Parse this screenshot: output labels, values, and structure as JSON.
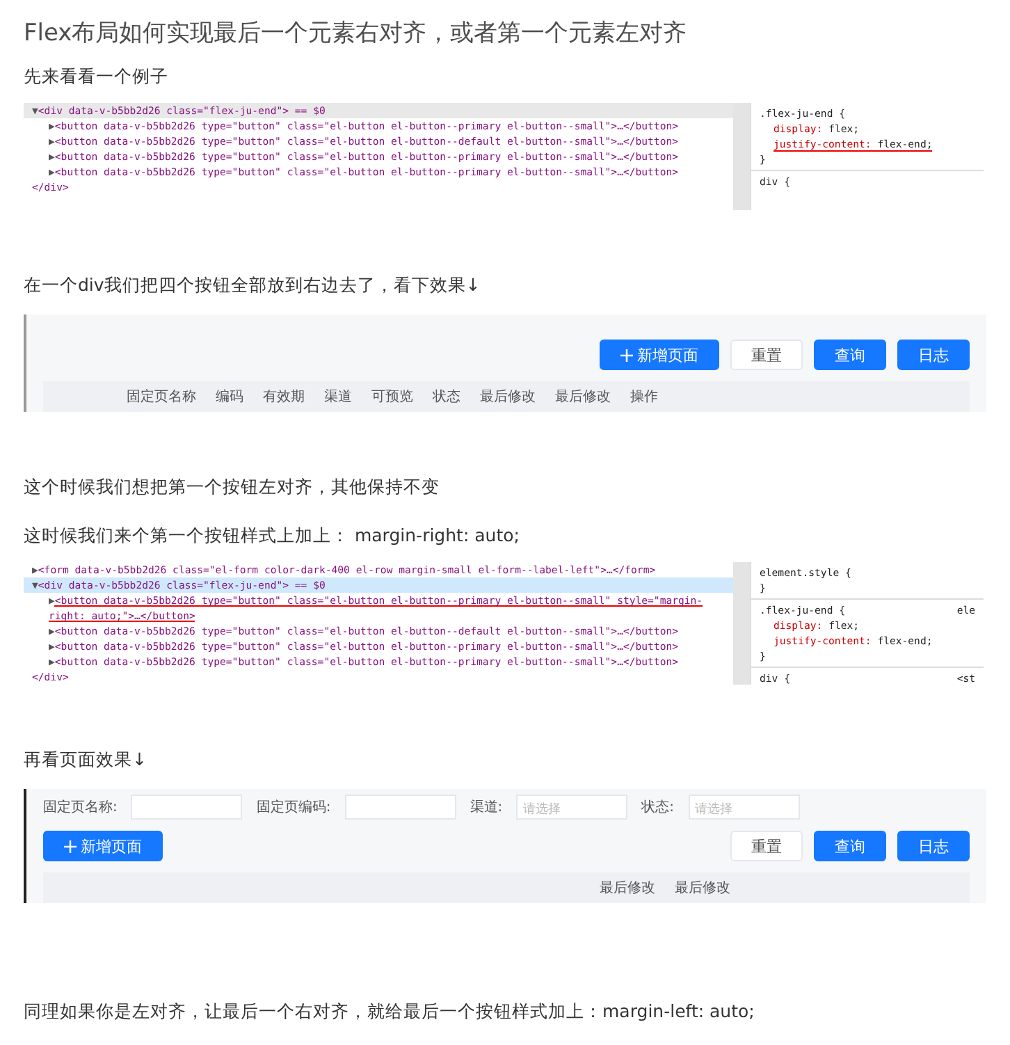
{
  "title": "Flex布局如何实现最后一个元素右对齐，或者第一个元素左对齐",
  "blocks": [
    {
      "kind": "text",
      "text": "先来看看一个例子"
    },
    {
      "kind": "devtools",
      "lines": [
        {
          "toggle": "▼",
          "text": "<div data-v-b5bb2d26 class=\"flex-ju-end\"> == $0",
          "selected": true,
          "underlined": false
        },
        {
          "toggle": "▶",
          "text": "<button data-v-b5bb2d26 type=\"button\" class=\"el-button el-button--primary el-button--small\">…</button>",
          "selected": false,
          "underlined": false
        },
        {
          "toggle": "▶",
          "text": "<button data-v-b5bb2d26 type=\"button\" class=\"el-button el-button--default el-button--small\">…</button>",
          "selected": false,
          "underlined": false
        },
        {
          "toggle": "▶",
          "text": "<button data-v-b5bb2d26 type=\"button\" class=\"el-button el-button--primary el-button--small\">…</button>",
          "selected": false,
          "underlined": false
        },
        {
          "toggle": "▶",
          "text": "<button data-v-b5bb2d26 type=\"button\" class=\"el-button el-button--primary el-button--small\">…</button>",
          "selected": false,
          "underlined": false
        },
        {
          "text": "</div>",
          "selected": false,
          "underlined": false
        }
      ],
      "styles": [
        {
          "kind": "selector",
          "text": ".flex-ju-end {"
        },
        {
          "kind": "prop",
          "name": "display:",
          "value": "flex;",
          "underlined": false
        },
        {
          "kind": "prop",
          "name": "justify-content:",
          "value": "flex-end;",
          "underlined": true
        },
        {
          "kind": "selector",
          "text": "}"
        },
        {
          "kind": "rule"
        },
        {
          "kind": "selector",
          "text": "div {"
        }
      ]
    },
    {
      "kind": "text",
      "text": "在一个div我们把四个按钮全部放到右边去了，看下效果↓"
    },
    {
      "kind": "preview",
      "buttons": [
        {
          "label": "新增页面",
          "kind": "add"
        },
        {
          "label": "重置",
          "kind": "default"
        },
        {
          "label": "查询",
          "kind": "primary"
        },
        {
          "label": "日志",
          "kind": "primary"
        }
      ],
      "columns": [
        "固定页名称",
        "编码",
        "有效期",
        "渠道",
        "可预览",
        "状态",
        "最后修改",
        "最后修改",
        "操作"
      ]
    },
    {
      "kind": "text",
      "text": "这个时候我们想把第一个按钮左对齐，其他保持不变"
    },
    {
      "kind": "text",
      "text": "这时候我们来个第一个按钮样式上加上： margin-right: auto;"
    },
    {
      "kind": "devtools",
      "lines": [
        {
          "toggle": "▶",
          "text": "<form data-v-b5bb2d26 class=\"el-form color-dark-400 el-row margin-small el-form--label-left\">…</form>",
          "selected": false,
          "underlined": false
        },
        {
          "toggle": "▼",
          "text": "<div data-v-b5bb2d26 class=\"flex-ju-end\"> == $0",
          "selected": true,
          "underlined": false
        },
        {
          "toggle": "▶",
          "text": "<button data-v-b5bb2d26 type=\"button\" class=\"el-button el-button--primary el-button--small\" style=\"margin-right: auto;\">…</button>",
          "selected": false,
          "underlined": true
        },
        {
          "toggle": "▶",
          "text": "<button data-v-b5bb2d26 type=\"button\" class=\"el-button el-button--default el-button--small\">…</button>",
          "selected": false,
          "underlined": false
        },
        {
          "toggle": "▶",
          "text": "<button data-v-b5bb2d26 type=\"button\" class=\"el-button el-button--primary el-button--small\">…</button>",
          "selected": false,
          "underlined": false
        },
        {
          "toggle": "▶",
          "text": "<button data-v-b5bb2d26 type=\"button\" class=\"el-button el-button--primary el-button--small\">…</button>",
          "selected": false,
          "underlined": false
        },
        {
          "text": "</div>",
          "selected": false,
          "underlined": false
        }
      ],
      "styles": [
        {
          "kind": "selector",
          "text": "element.style {"
        },
        {
          "kind": "selector",
          "text": "}"
        },
        {
          "kind": "rule"
        },
        {
          "kind": "selector",
          "text": ".flex-ju-end {",
          "aside": "ele"
        },
        {
          "kind": "prop",
          "name": "display:",
          "value": "flex;",
          "underlined": false
        },
        {
          "kind": "prop",
          "name": "justify-content:",
          "value": "flex-end;",
          "underlined": false
        },
        {
          "kind": "selector",
          "text": "}"
        },
        {
          "kind": "rule"
        },
        {
          "kind": "selector",
          "text": "div {",
          "aside": "<st"
        }
      ]
    },
    {
      "kind": "text",
      "text": "再看页面效果↓"
    },
    {
      "kind": "preview",
      "form": [
        {
          "label": "固定页名称:"
        },
        {
          "label": "固定页编码:"
        },
        {
          "label": "渠道:",
          "placeholder": "请选择"
        },
        {
          "label": "状态:",
          "placeholder": "请选择"
        }
      ],
      "buttons": [
        {
          "label": "新增页面",
          "kind": "add"
        },
        {
          "label": "重置",
          "kind": "default"
        },
        {
          "label": "查询",
          "kind": "primary"
        },
        {
          "label": "日志",
          "kind": "primary"
        }
      ],
      "columns": [
        "最后修改",
        "最后修改"
      ]
    },
    {
      "kind": "text",
      "text": "同理如果你是左对齐，让最后一个右对齐，就给最后一个按钮样式加上：margin-left: auto;"
    }
  ]
}
